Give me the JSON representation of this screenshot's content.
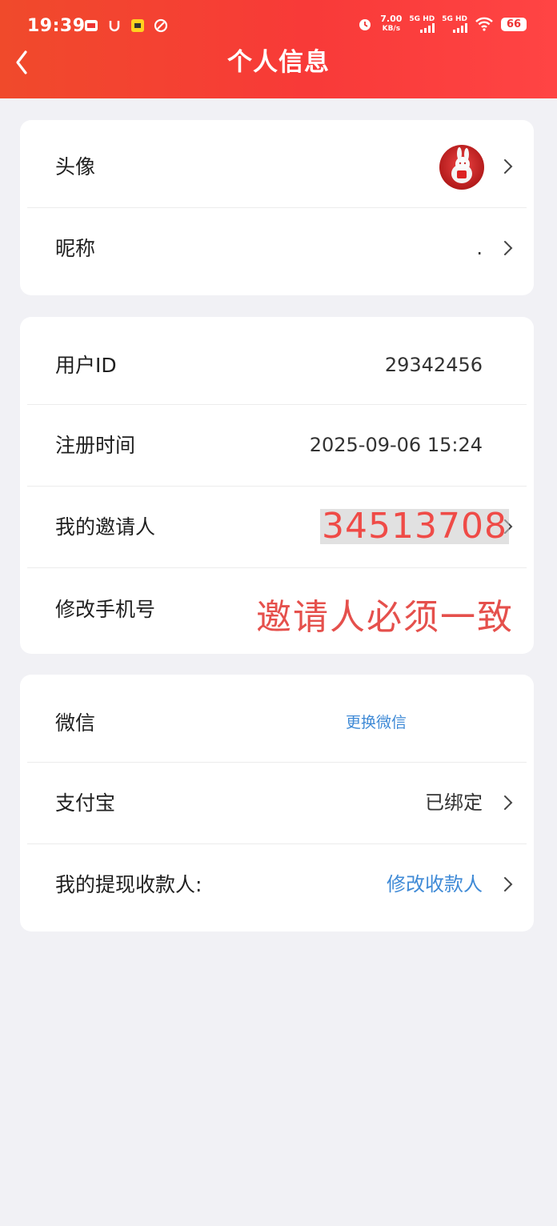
{
  "status_bar": {
    "time": "19:39",
    "net_speed": "7.00",
    "net_speed_unit": "KB/s",
    "sim1": "5G HD",
    "sim2": "5G HD",
    "battery": "66"
  },
  "header": {
    "title": "个人信息",
    "bg_color": "#f83a38"
  },
  "profile_card": {
    "avatar_label": "头像",
    "nickname_label": "昵称",
    "nickname_value": "."
  },
  "account_card": {
    "user_id_label": "用户ID",
    "user_id_value": "29342456",
    "register_label": "注册时间",
    "register_value": "2025-09-06 15:24",
    "inviter_label": "我的邀请人",
    "inviter_value": "34513708",
    "phone_label": "修改手机号"
  },
  "payment_card": {
    "wechat_label": "微信",
    "wechat_action": "更换微信",
    "alipay_label": "支付宝",
    "alipay_value": "已绑定",
    "payee_label": "我的提现收款人:",
    "payee_action": "修改收款人"
  },
  "annotation": {
    "note": "邀请人必须一致"
  },
  "icons": [
    "back-icon",
    "chevron-right-icon",
    "alarm-icon",
    "wifi-icon",
    "battery-icon",
    "avatar-bunny"
  ]
}
